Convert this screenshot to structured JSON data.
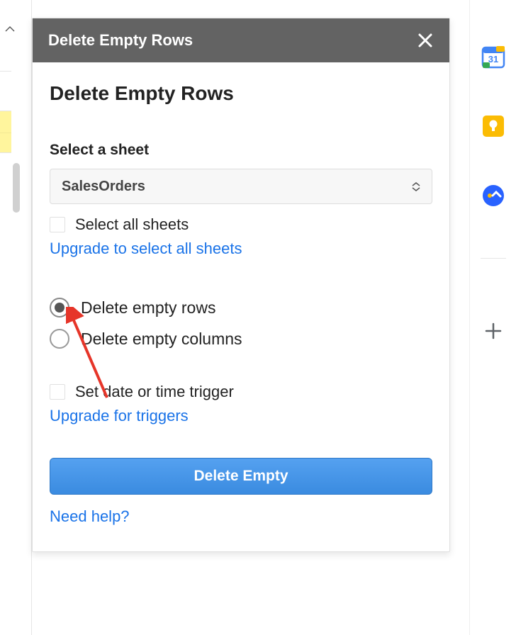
{
  "header": {
    "title": "Delete Empty Rows"
  },
  "panel": {
    "title": "Delete Empty Rows"
  },
  "sheet": {
    "label": "Select a sheet",
    "selected": "SalesOrders",
    "select_all_label": "Select all sheets",
    "upgrade_link": "Upgrade to select all sheets"
  },
  "radios": {
    "rows_label": "Delete empty rows",
    "columns_label": "Delete empty columns",
    "selected": "rows"
  },
  "trigger": {
    "label": "Set date or time trigger",
    "upgrade_link": "Upgrade for triggers"
  },
  "button": {
    "primary": "Delete Empty"
  },
  "help": {
    "link": "Need help?"
  },
  "sidebar": {
    "icons": [
      "calendar",
      "keep",
      "tasks",
      "plus"
    ]
  }
}
